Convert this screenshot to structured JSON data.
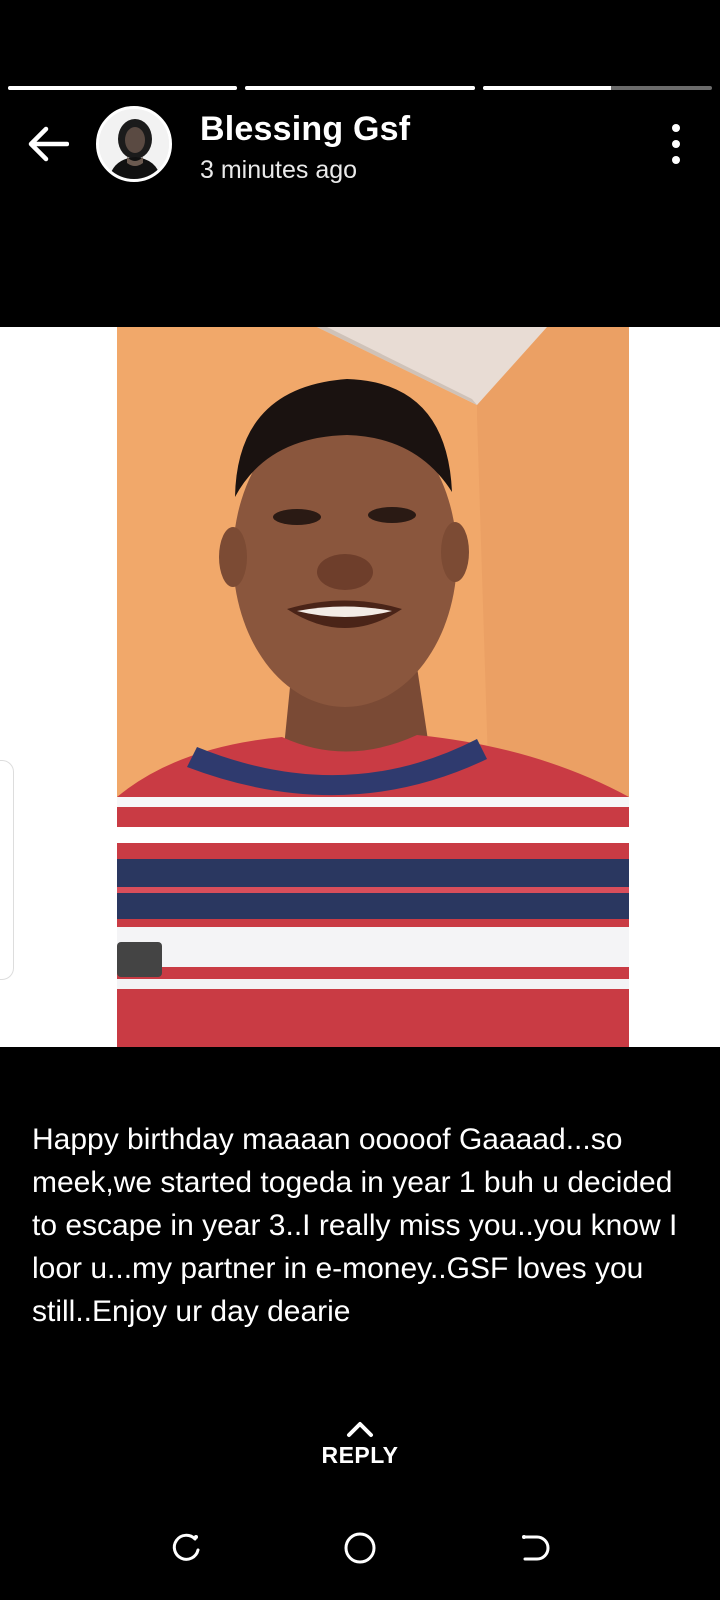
{
  "story": {
    "progress": [
      1.0,
      1.0,
      0.56
    ]
  },
  "header": {
    "name": "Blessing Gsf",
    "time": "3 minutes ago"
  },
  "caption": "Happy birthday maaaan ooooof Gaaaad...so meek,we started togeda in year 1 buh u decided to escape in year 3..I really miss you..you know I loor u...my partner in e-money..GSF loves you still..Enjoy ur day dearie",
  "reply": {
    "label": "REPLY"
  },
  "icons": {
    "back": "arrow-left-icon",
    "menu": "more-vertical-icon",
    "reply": "chevron-up-icon",
    "recents": "recents-icon",
    "home": "home-icon",
    "nav_back": "nav-back-icon"
  },
  "colors": {
    "background": "#000000",
    "progress_track": "#6b6b6b",
    "progress_fill": "#ffffff",
    "text": "#ffffff"
  }
}
